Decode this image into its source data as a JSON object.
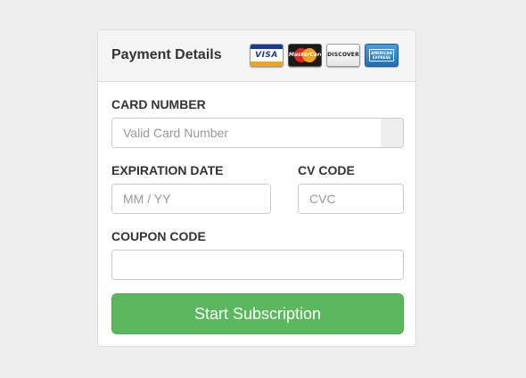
{
  "panel": {
    "title": "Payment Details",
    "card_logos": [
      {
        "name": "visa-logo",
        "text": "VISA"
      },
      {
        "name": "mastercard-logo",
        "text": "MasterCard"
      },
      {
        "name": "discover-logo",
        "text": "DISCOVER"
      },
      {
        "name": "amex-logo",
        "text": "AMERICAN EXPRESS"
      }
    ]
  },
  "form": {
    "card_number": {
      "label": "CARD NUMBER",
      "placeholder": "Valid Card Number",
      "value": ""
    },
    "expiration": {
      "label": "EXPIRATION DATE",
      "placeholder": "MM / YY",
      "value": ""
    },
    "cv_code": {
      "label": "CV CODE",
      "placeholder": "CVC",
      "value": ""
    },
    "coupon": {
      "label": "COUPON CODE",
      "placeholder": "",
      "value": ""
    },
    "submit_label": "Start Subscription"
  },
  "colors": {
    "page_background": "#eeeeee",
    "panel_heading": "#f5f5f5",
    "button": "#5cb85c"
  }
}
